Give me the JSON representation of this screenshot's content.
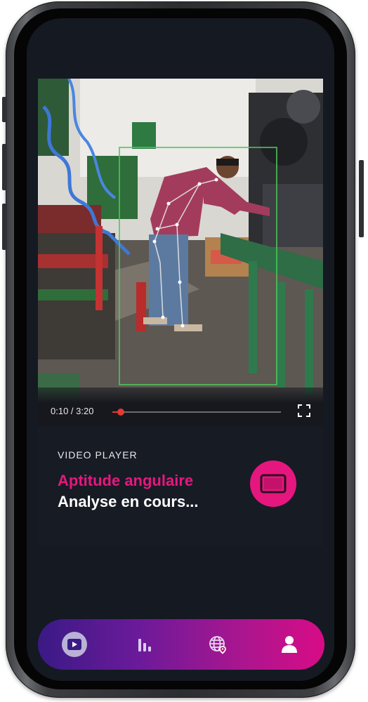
{
  "video": {
    "current_time": "0:10",
    "duration": "3:20",
    "time_display": "0:10 / 3:20",
    "progress": 0.05
  },
  "card": {
    "kicker": "VIDEO PLAYER",
    "title": "Aptitude angulaire",
    "status": "Analyse en cours..."
  },
  "icons": {
    "fullscreen": "fullscreen-icon",
    "screen": "screen-mode-icon",
    "tabs": [
      "video-play-icon",
      "bar-chart-icon",
      "globe-location-icon",
      "user-icon"
    ]
  },
  "colors": {
    "accent": "#e6167f",
    "screen_bg": "#151922",
    "progress": "#e53935",
    "tabbar_start": "#3a1a85",
    "tabbar_end": "#d80c86"
  }
}
